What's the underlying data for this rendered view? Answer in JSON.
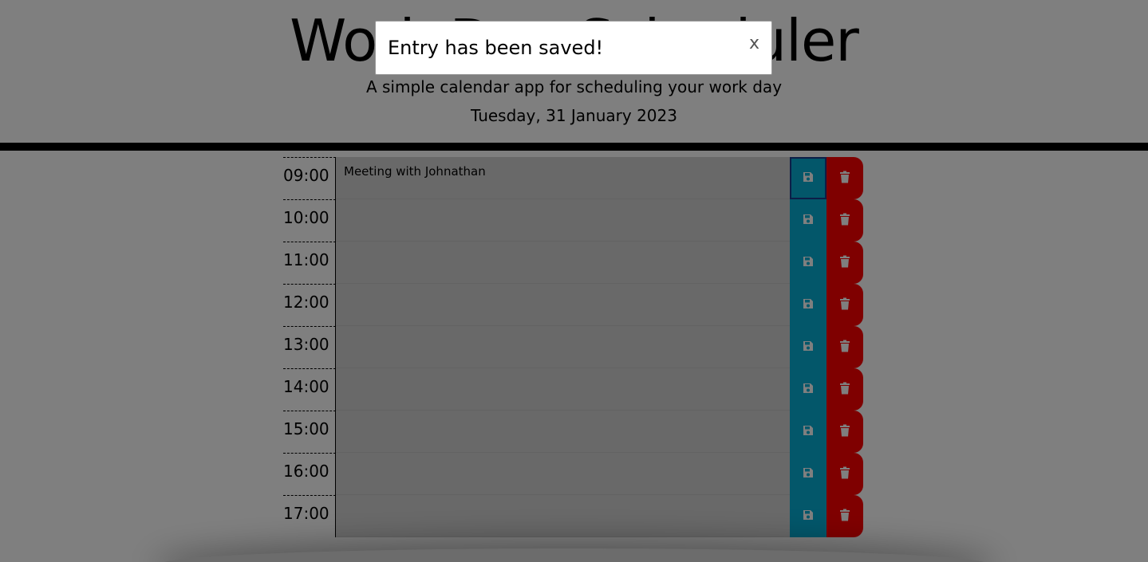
{
  "header": {
    "title": "Work Day Scheduler",
    "subtitle": "A simple calendar app for scheduling your work day",
    "current_day": "Tuesday, 31 January 2023"
  },
  "schedule": {
    "rows": [
      {
        "hour": "09:00",
        "entry": "Meeting with Johnathan"
      },
      {
        "hour": "10:00",
        "entry": ""
      },
      {
        "hour": "11:00",
        "entry": ""
      },
      {
        "hour": "12:00",
        "entry": ""
      },
      {
        "hour": "13:00",
        "entry": ""
      },
      {
        "hour": "14:00",
        "entry": ""
      },
      {
        "hour": "15:00",
        "entry": ""
      },
      {
        "hour": "16:00",
        "entry": ""
      },
      {
        "hour": "17:00",
        "entry": ""
      }
    ],
    "save_icon": "floppy-disk-icon",
    "delete_icon": "trash-icon"
  },
  "modal": {
    "message": "Entry has been saved!",
    "close_label": "x"
  },
  "colors": {
    "save": "#06aed5",
    "delete": "#ff0000",
    "row_bg": "#d3d3d3",
    "overlay": "rgba(0,0,0,0.5)"
  }
}
